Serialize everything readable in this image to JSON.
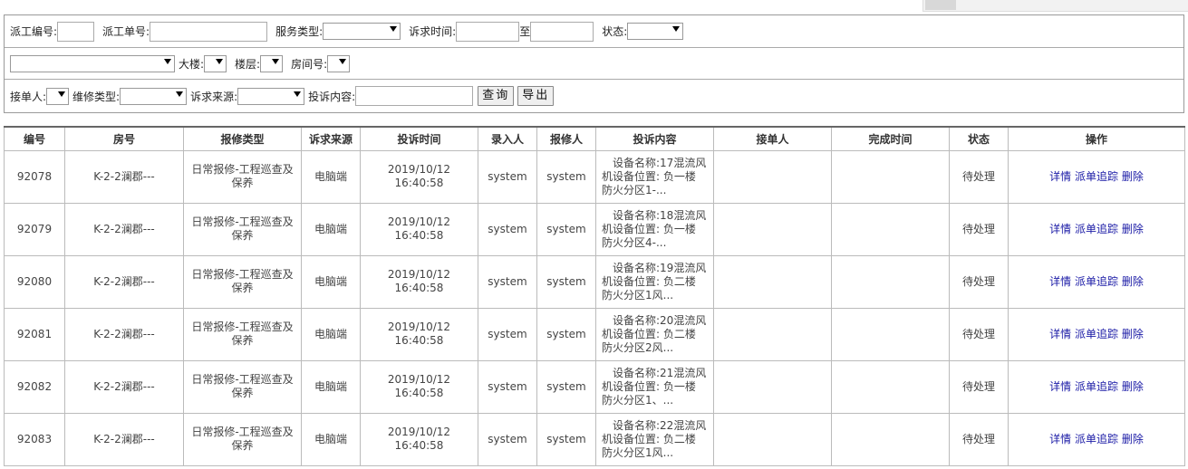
{
  "filters": {
    "dispatch_no_label": "派工编号:",
    "dispatch_form_label": "派工单号:",
    "service_type_label": "服务类型:",
    "request_time_label": "诉求时间:",
    "to_label": "至",
    "status_label": "状态:",
    "building_label": "大楼:",
    "floor_label": "楼层:",
    "room_label": "房间号:",
    "receiver_label": "接单人:",
    "repair_type_label": "维修类型:",
    "source_label": "诉求来源:",
    "complaint_label": "投诉内容:",
    "query_button": "查询",
    "export_button": "导出"
  },
  "table": {
    "headers": [
      "编号",
      "房号",
      "报修类型",
      "诉求来源",
      "投诉时间",
      "录入人",
      "报修人",
      "投诉内容",
      "接单人",
      "完成时间",
      "状态",
      "操作"
    ],
    "rows": [
      {
        "id": "92078",
        "room": "K-2-2澜郡---",
        "type": "日常报修-工程巡查及保养",
        "source": "电脑端",
        "time1": "2019/10/12",
        "time2": "16:40:58",
        "entry": "system",
        "reporter": "system",
        "content1": "设备名称:17混流风",
        "content2": "机设备位置: 负一楼",
        "content3": "防火分区1-...",
        "receiver": "",
        "finish": "",
        "status": "待处理"
      },
      {
        "id": "92079",
        "room": "K-2-2澜郡---",
        "type": "日常报修-工程巡查及保养",
        "source": "电脑端",
        "time1": "2019/10/12",
        "time2": "16:40:58",
        "entry": "system",
        "reporter": "system",
        "content1": "设备名称:18混流风",
        "content2": "机设备位置: 负一楼",
        "content3": "防火分区4-...",
        "receiver": "",
        "finish": "",
        "status": "待处理"
      },
      {
        "id": "92080",
        "room": "K-2-2澜郡---",
        "type": "日常报修-工程巡查及保养",
        "source": "电脑端",
        "time1": "2019/10/12",
        "time2": "16:40:58",
        "entry": "system",
        "reporter": "system",
        "content1": "设备名称:19混流风",
        "content2": "机设备位置: 负二楼",
        "content3": "防火分区1风...",
        "receiver": "",
        "finish": "",
        "status": "待处理"
      },
      {
        "id": "92081",
        "room": "K-2-2澜郡---",
        "type": "日常报修-工程巡查及保养",
        "source": "电脑端",
        "time1": "2019/10/12",
        "time2": "16:40:58",
        "entry": "system",
        "reporter": "system",
        "content1": "设备名称:20混流风",
        "content2": "机设备位置: 负二楼",
        "content3": "防火分区2风...",
        "receiver": "",
        "finish": "",
        "status": "待处理"
      },
      {
        "id": "92082",
        "room": "K-2-2澜郡---",
        "type": "日常报修-工程巡查及保养",
        "source": "电脑端",
        "time1": "2019/10/12",
        "time2": "16:40:58",
        "entry": "system",
        "reporter": "system",
        "content1": "设备名称:21混流风",
        "content2": "机设备位置: 负一楼",
        "content3": "防火分区1、...",
        "receiver": "",
        "finish": "",
        "status": "待处理"
      },
      {
        "id": "92083",
        "room": "K-2-2澜郡---",
        "type": "日常报修-工程巡查及保养",
        "source": "电脑端",
        "time1": "2019/10/12",
        "time2": "16:40:58",
        "entry": "system",
        "reporter": "system",
        "content1": "设备名称:22混流风",
        "content2": "机设备位置: 负二楼",
        "content3": "防火分区1风...",
        "receiver": "",
        "finish": "",
        "status": "待处理"
      }
    ],
    "ops": {
      "detail": "详情",
      "track": "派单追踪",
      "delete": "删除"
    }
  },
  "colors": {
    "link": "#1a1aa6",
    "border": "#bbbbbb"
  }
}
